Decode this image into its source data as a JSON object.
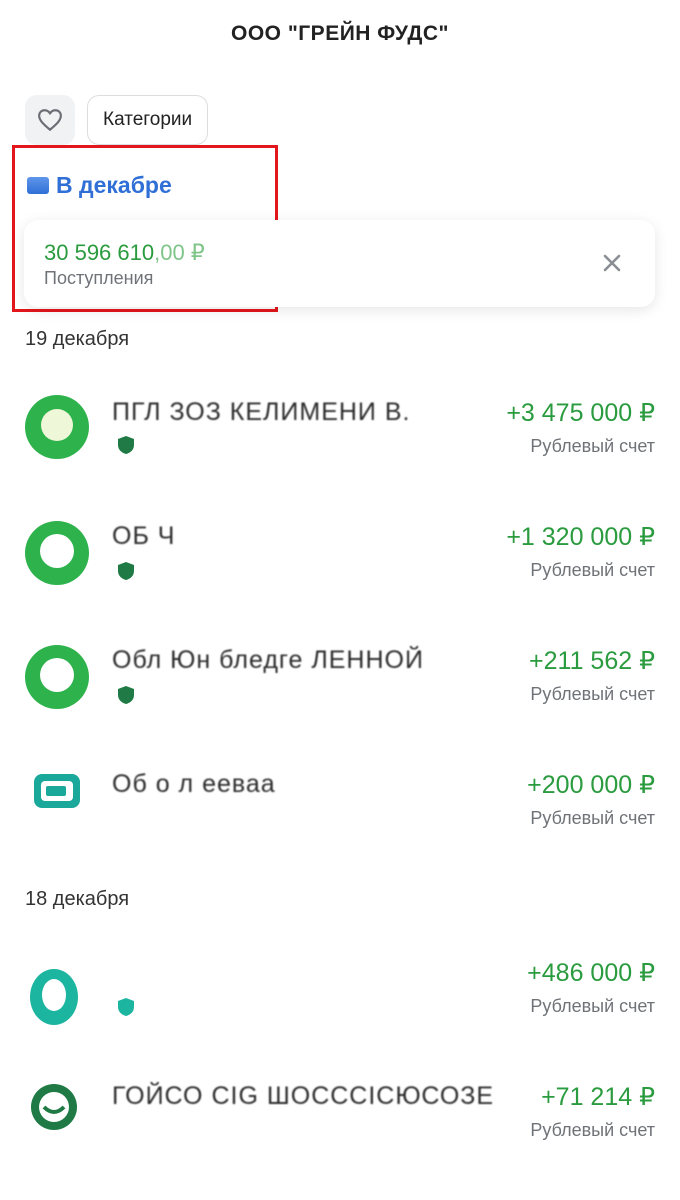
{
  "header": {
    "title": "ООО \"ГРЕЙН ФУДС\""
  },
  "filters": {
    "favorites_icon": "heart-icon",
    "categories_label": "Категории"
  },
  "period": {
    "label": "В декабре",
    "icon": "calendar-card-icon"
  },
  "summary": {
    "amount_main": "30 596 610",
    "amount_kopecks": ",00 ₽",
    "label": "Поступления",
    "close_icon": "close-icon"
  },
  "colors": {
    "income": "#2a9b3e",
    "accent": "#2f6fd6",
    "highlight": "#e3161b"
  },
  "days": [
    {
      "label": "19 декабря",
      "transactions": [
        {
          "name": "ПГЛ ЗОЗ КЕЛИМЕНИ В.",
          "amount": "+3 475 000 ₽",
          "account": "Рублевый счет"
        },
        {
          "name": "ОБ Ч",
          "amount": "+1 320 000 ₽",
          "account": "Рублевый счет"
        },
        {
          "name": "Обл Юн бледге ЛЕННОЙ",
          "amount": "+211 562 ₽",
          "account": "Рублевый счет"
        },
        {
          "name": "Об о л ееваа",
          "amount": "+200 000 ₽",
          "account": "Рублевый счет"
        }
      ]
    },
    {
      "label": "18 декабря",
      "transactions": [
        {
          "name": "",
          "amount": "+486 000 ₽",
          "account": "Рублевый счет"
        },
        {
          "name": "ГОЙСО СІG ШОСССІСЮСОЗЕ",
          "amount": "+71 214 ₽",
          "account": "Рублевый счет"
        }
      ]
    }
  ]
}
